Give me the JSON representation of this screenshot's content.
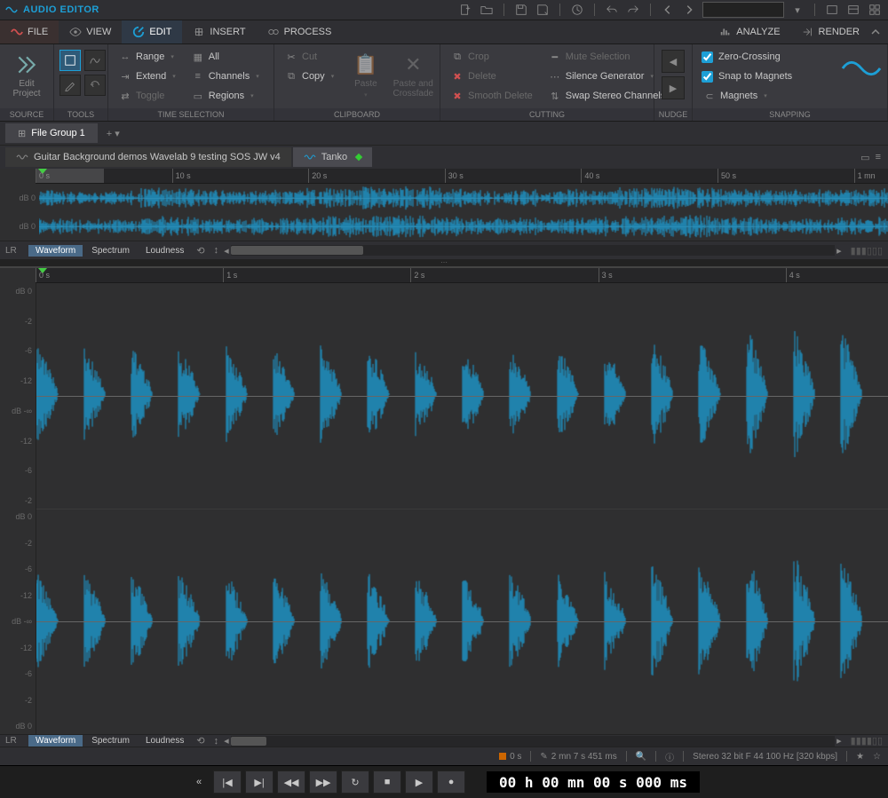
{
  "app_title": "AUDIO EDITOR",
  "menu": {
    "file": "FILE",
    "view": "VIEW",
    "edit": "EDIT",
    "insert": "INSERT",
    "process": "PROCESS",
    "analyze": "ANALYZE",
    "render": "RENDER"
  },
  "ribbon": {
    "source": {
      "label": "SOURCE",
      "edit_project": "Edit Project"
    },
    "tools": {
      "label": "TOOLS"
    },
    "time_selection": {
      "label": "TIME SELECTION",
      "range": "Range",
      "extend": "Extend",
      "toggle": "Toggle",
      "all": "All",
      "channels": "Channels",
      "regions": "Regions"
    },
    "clipboard": {
      "label": "CLIPBOARD",
      "cut": "Cut",
      "copy": "Copy",
      "paste": "Paste",
      "paste_crossfade": "Paste and Crossfade"
    },
    "cutting": {
      "label": "CUTTING",
      "crop": "Crop",
      "delete": "Delete",
      "smooth_delete": "Smooth Delete",
      "mute_selection": "Mute Selection",
      "silence_generator": "Silence Generator",
      "swap_stereo": "Swap Stereo Channels"
    },
    "nudge": {
      "label": "NUDGE"
    },
    "snapping": {
      "label": "SNAPPING",
      "zero": "Zero-Crossing",
      "magnets_snap": "Snap to Magnets",
      "magnets": "Magnets"
    }
  },
  "file_group": "File Group 1",
  "files": {
    "tab1": "Guitar Background demos Wavelab 9 testing SOS JW v4",
    "tab2": "Tanko"
  },
  "overview": {
    "ticks": [
      "0 s",
      "10 s",
      "20 s",
      "30 s",
      "40 s",
      "50 s",
      "1 mn"
    ],
    "db": "dB 0",
    "lr": "LR"
  },
  "bigview": {
    "ticks": [
      "0 s",
      "1 s",
      "2 s",
      "3 s",
      "4 s"
    ],
    "scale": [
      "dB 0",
      "-2",
      "-6",
      "-12",
      "dB -∞",
      "-12",
      "-6",
      "-2",
      "dB 0"
    ]
  },
  "viewtabs": {
    "waveform": "Waveform",
    "spectrum": "Spectrum",
    "loudness": "Loudness"
  },
  "status": {
    "pos": "0 s",
    "dur": "2 mn 7 s 451 ms",
    "format": "Stereo 32 bit F 44 100 Hz [320 kbps]"
  },
  "transport": {
    "time": "00 h 00 mn 00 s 000 ms"
  }
}
